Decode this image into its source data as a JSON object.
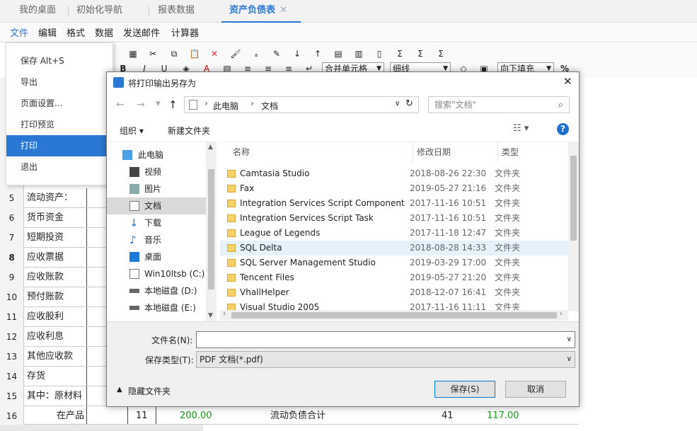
{
  "tabs": [
    {
      "label": "我的桌面"
    },
    {
      "label": "初始化导航"
    },
    {
      "label": "报表数据"
    },
    {
      "label": "资产负债表"
    }
  ],
  "tab_close": "✕",
  "menu": [
    "文件",
    "编辑",
    "格式",
    "数据",
    "发送邮件",
    "计算器"
  ],
  "file_menu": [
    "保存 Alt+S",
    "导出",
    "页面设置...",
    "打印预览",
    "打印",
    "退出"
  ],
  "toolbar": {
    "merge": "合并单元格",
    "border": "细线",
    "fill": "向下填充",
    "percent": "%"
  },
  "sheet_rows": [
    {
      "n": "5",
      "label": "流动资产："
    },
    {
      "n": "6",
      "label": "货币资金"
    },
    {
      "n": "7",
      "label": "短期投资"
    },
    {
      "n": "8",
      "label": "应收票据"
    },
    {
      "n": "9",
      "label": "应收账款"
    },
    {
      "n": "10",
      "label": "预付账款"
    },
    {
      "n": "11",
      "label": "应收股利"
    },
    {
      "n": "12",
      "label": "应收利息"
    },
    {
      "n": "13",
      "label": "其他应收款"
    },
    {
      "n": "14",
      "label": "存货"
    },
    {
      "n": "15",
      "label": "其中：原材料"
    },
    {
      "n": "16",
      "label": "在产品",
      "c2": "11",
      "c3": "200.00",
      "c4": "流动负债合计",
      "c5": "41",
      "c6": "117.00"
    }
  ],
  "dialog": {
    "title": "将打印输出另存为",
    "breadcrumb": [
      "此电脑",
      "文档"
    ],
    "search_placeholder": "搜索\"文档\"",
    "organize": "组织 ▾",
    "new_folder": "新建文件夹",
    "tree": [
      "此电脑",
      "视频",
      "图片",
      "文档",
      "下载",
      "音乐",
      "桌面",
      "Win10ltsb (C:)",
      "本地磁盘 (D:)",
      "本地磁盘 (E:)"
    ],
    "columns": [
      "名称",
      "修改日期",
      "类型"
    ],
    "files": [
      {
        "name": "Camtasia Studio",
        "date": "2018-08-26 22:30",
        "type": "文件夹"
      },
      {
        "name": "Fax",
        "date": "2019-05-27 21:16",
        "type": "文件夹"
      },
      {
        "name": "Integration Services Script Component",
        "date": "2017-11-16 10:51",
        "type": "文件夹"
      },
      {
        "name": "Integration Services Script Task",
        "date": "2017-11-16 10:51",
        "type": "文件夹"
      },
      {
        "name": "League of Legends",
        "date": "2017-11-18 12:47",
        "type": "文件夹"
      },
      {
        "name": "SQL Delta",
        "date": "2018-08-28 14:33",
        "type": "文件夹"
      },
      {
        "name": "SQL Server Management Studio",
        "date": "2019-03-29 17:00",
        "type": "文件夹"
      },
      {
        "name": "Tencent Files",
        "date": "2019-05-27 21:20",
        "type": "文件夹"
      },
      {
        "name": "VhallHelper",
        "date": "2018-12-07 16:41",
        "type": "文件夹"
      },
      {
        "name": "Visual Studio 2005",
        "date": "2017-11-16 11:11",
        "type": "文件夹"
      }
    ],
    "filename_label": "文件名(N):",
    "filename_value": "",
    "filetype_label": "保存类型(T):",
    "filetype_value": "PDF 文档(*.pdf)",
    "hide_folders": "隐藏文件夹",
    "save": "保存(S)",
    "cancel": "取消"
  }
}
